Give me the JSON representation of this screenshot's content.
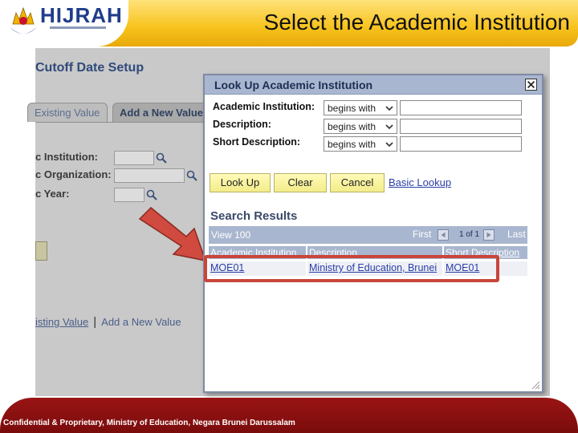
{
  "slide": {
    "title": "Select the Academic Institution",
    "logo_text": "HIJRAH",
    "footer_text": "Confidential & Proprietary, Ministry of Education, Negara Brunei Darussalam"
  },
  "background_page": {
    "title": "Cutoff Date Setup",
    "tabs": [
      "Existing Value",
      "Add a New Value"
    ],
    "fields": [
      {
        "label": "c Institution:"
      },
      {
        "label": "c Organization:"
      },
      {
        "label": "c Year:"
      }
    ],
    "bottom_links": {
      "left": "isting Value",
      "separator": "|",
      "right": "Add a New Value"
    }
  },
  "modal": {
    "title": "Look Up Academic Institution",
    "criteria": [
      {
        "label": "Academic Institution:",
        "operator": "begins with",
        "value": ""
      },
      {
        "label": "Description:",
        "operator": "begins with",
        "value": ""
      },
      {
        "label": "Short Description:",
        "operator": "begins with",
        "value": ""
      }
    ],
    "buttons": {
      "lookup": "Look Up",
      "clear": "Clear",
      "cancel": "Cancel",
      "basic_lookup": "Basic Lookup"
    },
    "results": {
      "heading": "Search Results",
      "view_label": "View 100",
      "first_label": "First",
      "count_label": "1 of 1",
      "last_label": "Last",
      "columns": [
        "Academic Institution",
        "Description",
        "Short Description"
      ],
      "rows": [
        [
          "MOE01",
          "Ministry of Education, Brunei",
          "MOE01"
        ]
      ]
    }
  },
  "colors": {
    "header_gold": "#f7c21b",
    "footer_red": "#8a1010",
    "highlight_red": "#c9453a",
    "modal_title_bar": "#a9b6cf",
    "link_blue": "#2b3ea6"
  }
}
